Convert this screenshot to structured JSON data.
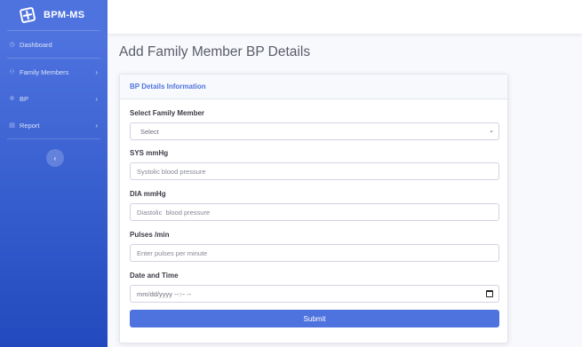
{
  "brand": {
    "name": "BPM-MS",
    "icon": "medical-kit-icon"
  },
  "sidebar": {
    "items": [
      {
        "label": "Dashboard",
        "icon": "dashboard-icon",
        "has_chevron": false
      },
      {
        "label": "Family Members",
        "icon": "users-icon",
        "has_chevron": true
      },
      {
        "label": "BP",
        "icon": "heart-icon",
        "has_chevron": true
      },
      {
        "label": "Report",
        "icon": "file-icon",
        "has_chevron": true
      }
    ],
    "toggle_icon": "chevron-left-icon",
    "chevron": "›",
    "toggle_glyph": "‹"
  },
  "page": {
    "title": "Add Family Member BP Details"
  },
  "card": {
    "header": "BP Details Information",
    "fields": {
      "family_member": {
        "label": "Select Family Member",
        "value": "Select"
      },
      "sys": {
        "label": "SYS mmHg",
        "placeholder": "Systolic blood pressure"
      },
      "dia": {
        "label": "DIA mmHg",
        "placeholder": "Diastolic  blood pressure"
      },
      "pulses": {
        "label": "Pulses /min",
        "placeholder": "Enter pulses per minute"
      },
      "datetime": {
        "label": "Date and Time",
        "value": "mm/dd/yyyy --:-- --"
      }
    },
    "submit_label": "Submit"
  },
  "colors": {
    "primary": "#4e73df",
    "sidebar_bottom": "#224abe",
    "text": "#5a5c69"
  }
}
